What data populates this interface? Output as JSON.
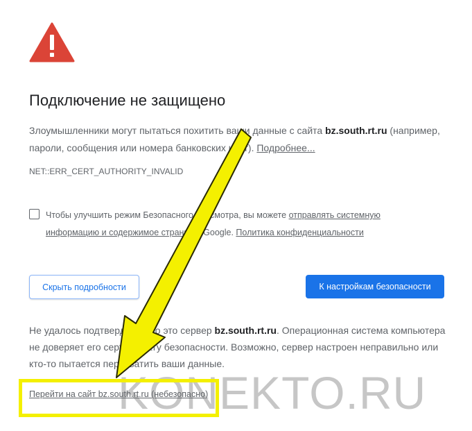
{
  "title": "Подключение не защищено",
  "main_message": {
    "part1": "Злоумышленники могут пытаться похитить ваши данные с сайта ",
    "host": "bz.south.rt.ru",
    "part2": " (например, пароли, сообщения или номера банковских карт). ",
    "learn_more": "Подробнее..."
  },
  "error_code": "NET::ERR_CERT_AUTHORITY_INVALID",
  "safe_browsing": {
    "checked": false,
    "text_before": "Чтобы улучшить режим Безопасного просмотра, вы можете ",
    "link_send": "отправлять системную информацию и содержимое страниц",
    "text_middle": " в Google. ",
    "link_privacy": "Политика конфиденциальности"
  },
  "buttons": {
    "hide_details": "Скрыть подробности",
    "back_to_safety": "К настройкам безопасности"
  },
  "details": {
    "part1": "Не удалось подтвердить, что это сервер ",
    "host": "bz.south.rt.ru",
    "part2": ". Операционная система компьютера не доверяет его сертификату безопасности. Возможно, сервер настроен неправильно или кто-то пытается перехватить ваши данные."
  },
  "proceed_link": "Перейти на сайт bz.south.rt.ru (небезопасно)",
  "watermark": "KONEKTO.RU",
  "colors": {
    "warning_red": "#db4437",
    "primary_blue": "#1a73e8",
    "annotation_yellow": "#f4f000"
  }
}
